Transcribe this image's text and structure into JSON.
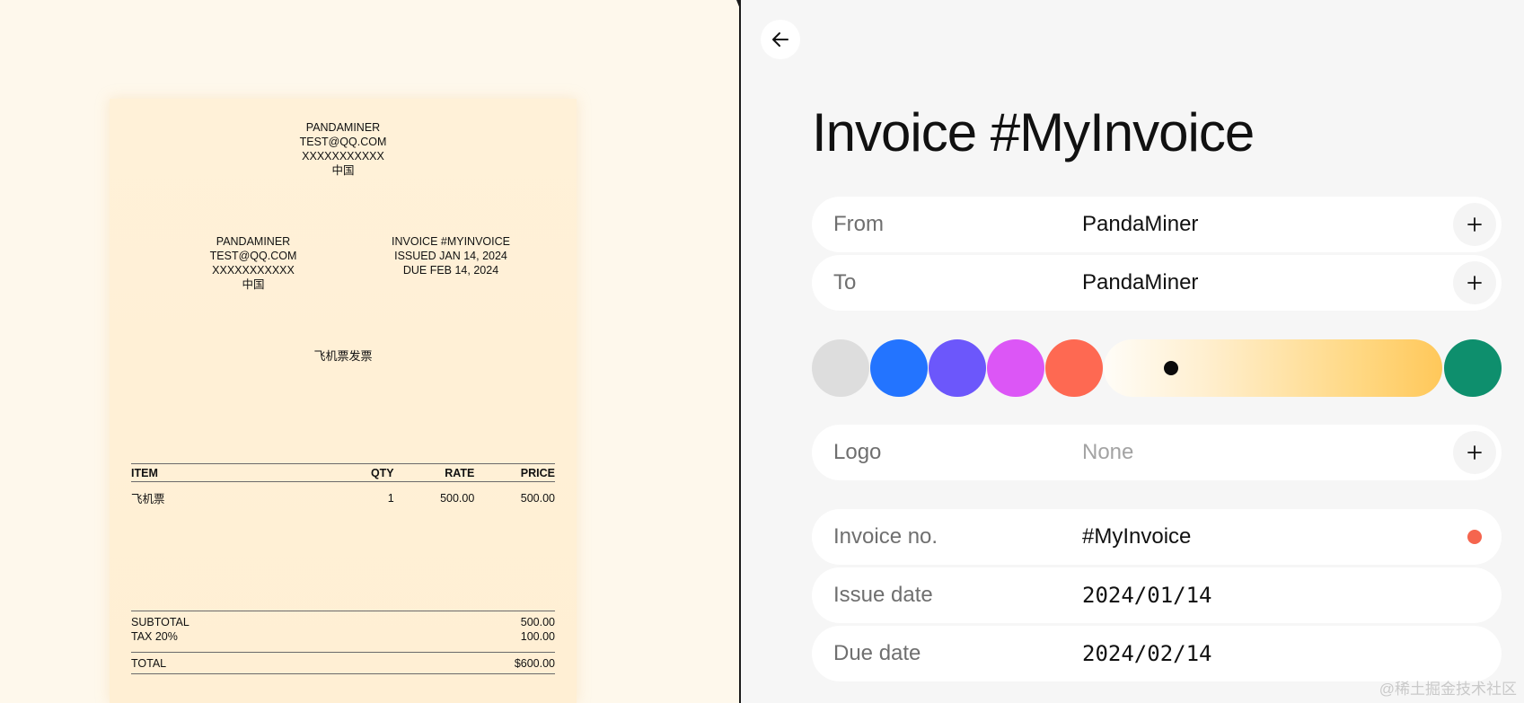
{
  "invoice_preview": {
    "header": {
      "name": "PANDAMINER",
      "email": "TEST@QQ.COM",
      "phone": "XXXXXXXXXXX",
      "country": "中国"
    },
    "to_block": {
      "name": "PANDAMINER",
      "email": "TEST@QQ.COM",
      "phone": "XXXXXXXXXXX",
      "country": "中国"
    },
    "meta": {
      "invoice": "INVOICE #MYINVOICE",
      "issued": "ISSUED JAN 14, 2024",
      "due": "DUE FEB 14, 2024"
    },
    "note": "飞机票发票",
    "table": {
      "headers": {
        "item": "ITEM",
        "qty": "QTY",
        "rate": "RATE",
        "price": "PRICE"
      },
      "rows": [
        {
          "item": "飞机票",
          "qty": "1",
          "rate": "500.00",
          "price": "500.00"
        }
      ]
    },
    "totals": {
      "subtotal_label": "SUBTOTAL",
      "subtotal": "500.00",
      "tax_label": "TAX 20%",
      "tax": "100.00",
      "total_label": "TOTAL",
      "total": "$600.00"
    }
  },
  "editor": {
    "title": "Invoice #MyInvoice",
    "back_icon": "arrow-left-icon",
    "from": {
      "label": "From",
      "value": "PandaMiner"
    },
    "to": {
      "label": "To",
      "value": "PandaMiner"
    },
    "swatches": [
      {
        "name": "gray",
        "color": "#dddddd"
      },
      {
        "name": "blue",
        "color": "#2374ff"
      },
      {
        "name": "indigo",
        "color": "#6c57fb"
      },
      {
        "name": "magenta",
        "color": "#dc56f6"
      },
      {
        "name": "coral",
        "color": "#fe6952"
      },
      {
        "name": "green",
        "color": "#0e8f6d"
      }
    ],
    "gradient_slider": {
      "level": 0.2
    },
    "logo": {
      "label": "Logo",
      "value": "None"
    },
    "invoice_no": {
      "label": "Invoice no.",
      "value": "#MyInvoice",
      "status_color": "#f5654e"
    },
    "issue_date": {
      "label": "Issue date",
      "value": "2024/01/14"
    },
    "due_date": {
      "label": "Due date",
      "value": "2024/02/14"
    }
  },
  "watermark": "@稀土掘金技术社区"
}
